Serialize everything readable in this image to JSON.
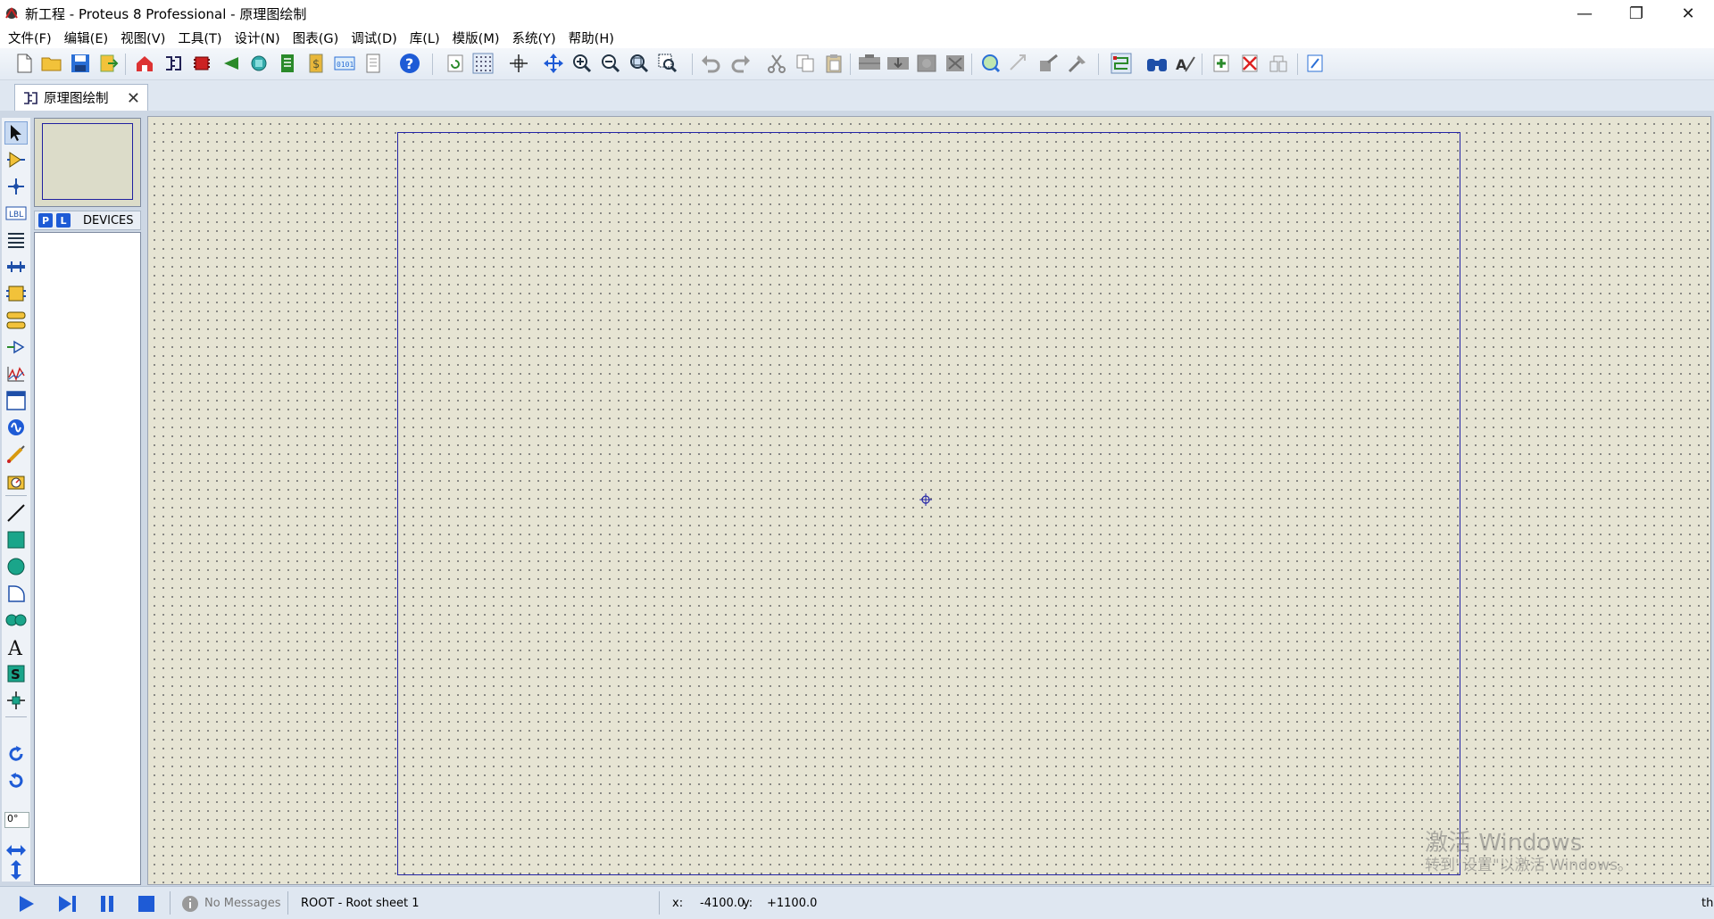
{
  "window": {
    "title": "新工程 - Proteus 8 Professional - 原理图绘制",
    "minimize_glyph": "—",
    "restore_glyph": "❐",
    "close_glyph": "✕"
  },
  "menu": [
    "文件(F)",
    "编辑(E)",
    "视图(V)",
    "工具(T)",
    "设计(N)",
    "图表(G)",
    "调试(D)",
    "库(L)",
    "模版(M)",
    "系统(Y)",
    "帮助(H)"
  ],
  "toolbar_icons": [
    "new-file-icon",
    "open-folder-icon",
    "save-icon",
    "import-icon",
    "home-icon",
    "schematic-icon",
    "pcb-icon",
    "gerber-icon",
    "3d-viewer-icon",
    "bom-icon",
    "dollar-icon",
    "binary-icon",
    "notes-icon",
    "help-icon",
    "refresh-icon",
    "grid-icon",
    "origin-icon",
    "pan-icon",
    "zoom-in-icon",
    "zoom-out-icon",
    "zoom-all-icon",
    "zoom-area-icon",
    "undo-icon",
    "redo-icon",
    "cut-icon",
    "copy-icon",
    "paste-icon",
    "block-copy-icon",
    "block-move-icon",
    "block-rotate-icon",
    "block-delete-icon",
    "pick-device-icon",
    "make-device-icon",
    "packaging-icon",
    "decompose-icon",
    "wire-autorouter-icon",
    "search-icon",
    "property-assignment-icon",
    "new-sheet-icon",
    "delete-sheet-icon",
    "goto-sheet-icon",
    "netlist-icon"
  ],
  "tab": {
    "label": "原理图绘制",
    "close_glyph": "✕"
  },
  "left_tools": [
    "selection-mode-icon",
    "component-mode-icon",
    "junction-dot-icon",
    "wire-label-icon",
    "text-script-icon",
    "buses-icon",
    "subcircuit-icon",
    "terminals-icon",
    "device-pins-icon",
    "graph-icon",
    "tape-recorder-icon",
    "generator-icon",
    "voltage-probe-icon",
    "virtual-instruments-icon",
    "line-icon",
    "box-icon",
    "circle-icon",
    "arc-icon",
    "path-icon",
    "text-icon",
    "symbol-icon",
    "marker-icon",
    "rotate-clockwise-icon",
    "rotate-anticlockwise-icon",
    "mirror-horizontal-icon",
    "mirror-vertical-icon"
  ],
  "rotation_value": "0°",
  "panel": {
    "p_button": "P",
    "l_button": "L",
    "devices_label": "DEVICES"
  },
  "status": {
    "messages": "No Messages",
    "sheet": "ROOT - Root sheet 1",
    "x_label": "x:",
    "x_value": "-4100.0",
    "y_label": "y:",
    "y_value": "+1100.0",
    "units": "th"
  },
  "watermark": {
    "line1": "激活 Windows",
    "line2": "转到\"设置\"以激活 Windows。"
  },
  "colors": {
    "accent": "#1e5bd6",
    "sheet_border": "#2424a6",
    "canvas": "#e6e4d3"
  }
}
